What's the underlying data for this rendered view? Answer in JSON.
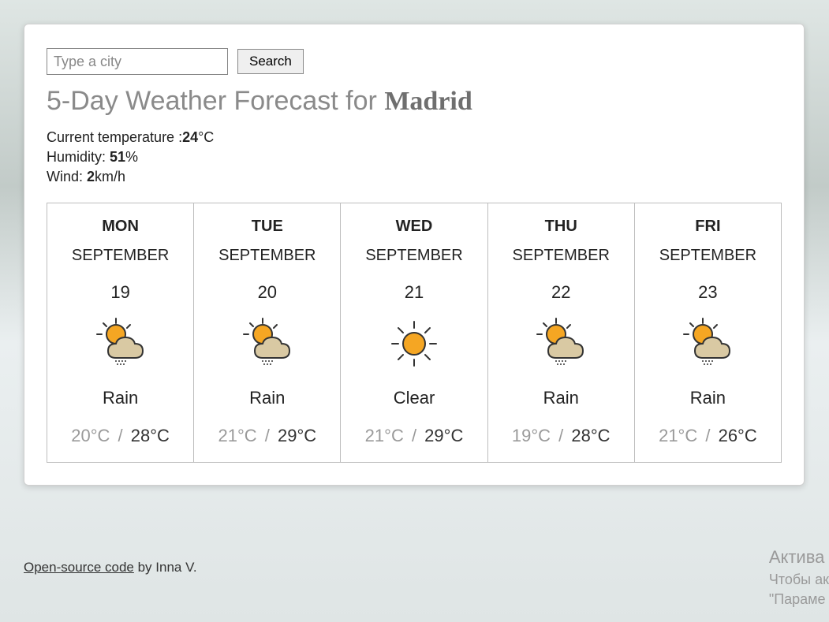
{
  "search": {
    "placeholder": "Type a city",
    "button": "Search"
  },
  "title_prefix": "5-Day Weather Forecast for ",
  "city": "Madrid",
  "current": {
    "temp_label": "Current temperature :",
    "temp_value": "24",
    "temp_unit": "°C",
    "humidity_label": "Humidity: ",
    "humidity_value": "51",
    "humidity_unit": "%",
    "wind_label": "Wind: ",
    "wind_value": "2",
    "wind_unit": "km/h"
  },
  "forecast": [
    {
      "dow": "MON",
      "month": "SEPTEMBER",
      "date": "19",
      "icon": "rain",
      "condition": "Rain",
      "low": "20°C",
      "high": "28°C"
    },
    {
      "dow": "TUE",
      "month": "SEPTEMBER",
      "date": "20",
      "icon": "rain",
      "condition": "Rain",
      "low": "21°C",
      "high": "29°C"
    },
    {
      "dow": "WED",
      "month": "SEPTEMBER",
      "date": "21",
      "icon": "clear",
      "condition": "Clear",
      "low": "21°C",
      "high": "29°C"
    },
    {
      "dow": "THU",
      "month": "SEPTEMBER",
      "date": "22",
      "icon": "rain",
      "condition": "Rain",
      "low": "19°C",
      "high": "28°C"
    },
    {
      "dow": "FRI",
      "month": "SEPTEMBER",
      "date": "23",
      "icon": "rain",
      "condition": "Rain",
      "low": "21°C",
      "high": "26°C"
    }
  ],
  "footer": {
    "link_text": "Open-source code",
    "by_text": " by Inna V."
  },
  "watermark": {
    "line1": "Актива",
    "line2": "Чтобы ак",
    "line3": "\"Параме"
  }
}
